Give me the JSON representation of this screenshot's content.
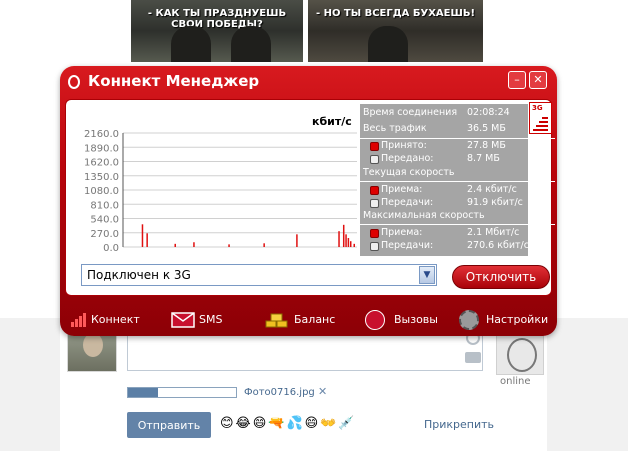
{
  "background": {
    "meme_left_caption": "- КАК ТЫ ПРАЗДНУЕШЬ СВОИ ПОБЕДЫ?",
    "meme_right_caption": "- НО ТЫ ВСЕГДА БУХАЕШЬ!",
    "friend_status": "online",
    "attachment_name": "Фото0716.jpg",
    "attachment_progress": 0.28,
    "send_label": "Отправить",
    "attach_label": "Прикрепить",
    "emojis": "😊😂😄🔫💦😄👐💉"
  },
  "window": {
    "title": "Коннект Менеджер",
    "minimize_icon": "–",
    "close_icon": "✕"
  },
  "chart_data": {
    "type": "bar",
    "unit_label": "кбит/с",
    "yticks": [
      "2160.0",
      "1890.0",
      "1620.0",
      "1350.0",
      "1080.0",
      "810.0",
      "540.0",
      "270.0",
      "0.0"
    ],
    "ylim": [
      0,
      2160
    ],
    "grid": true,
    "bursts": [
      {
        "pos": 0.08,
        "value": 430
      },
      {
        "pos": 0.1,
        "value": 260
      },
      {
        "pos": 0.22,
        "value": 60
      },
      {
        "pos": 0.3,
        "value": 90
      },
      {
        "pos": 0.45,
        "value": 50
      },
      {
        "pos": 0.6,
        "value": 70
      },
      {
        "pos": 0.74,
        "value": 240
      },
      {
        "pos": 0.92,
        "value": 300
      },
      {
        "pos": 0.94,
        "value": 420
      },
      {
        "pos": 0.95,
        "value": 240
      },
      {
        "pos": 0.96,
        "value": 170
      },
      {
        "pos": 0.97,
        "value": 110
      },
      {
        "pos": 0.985,
        "value": 60
      }
    ]
  },
  "stats": {
    "conn_time_label": "Время соединения",
    "conn_time_value": "02:08:24",
    "total_traffic_label": "Весь трафик",
    "total_traffic_value": "36.5 МБ",
    "received_label": "Принято:",
    "received_value": "27.8 МБ",
    "sent_label": "Передано:",
    "sent_value": "8.7 МБ",
    "current_speed_label": "Текущая скорость",
    "cur_recv_label": "Приема:",
    "cur_recv_value": "2.4 кбит/с",
    "cur_send_label": "Передачи:",
    "cur_send_value": "91.9 кбит/с",
    "max_speed_label": "Максимальная скорость",
    "max_recv_label": "Приема:",
    "max_recv_value": "2.1 Мбит/с",
    "max_send_label": "Передачи:",
    "max_send_value": "270.6 кбит/с",
    "signal_label": "3G"
  },
  "controls": {
    "status_value": "Подключен к 3G",
    "disconnect_label": "Отключить"
  },
  "nav": {
    "connect": "Коннект",
    "sms": "SMS",
    "balance": "Баланс",
    "calls": "Вызовы",
    "settings": "Настройки"
  }
}
